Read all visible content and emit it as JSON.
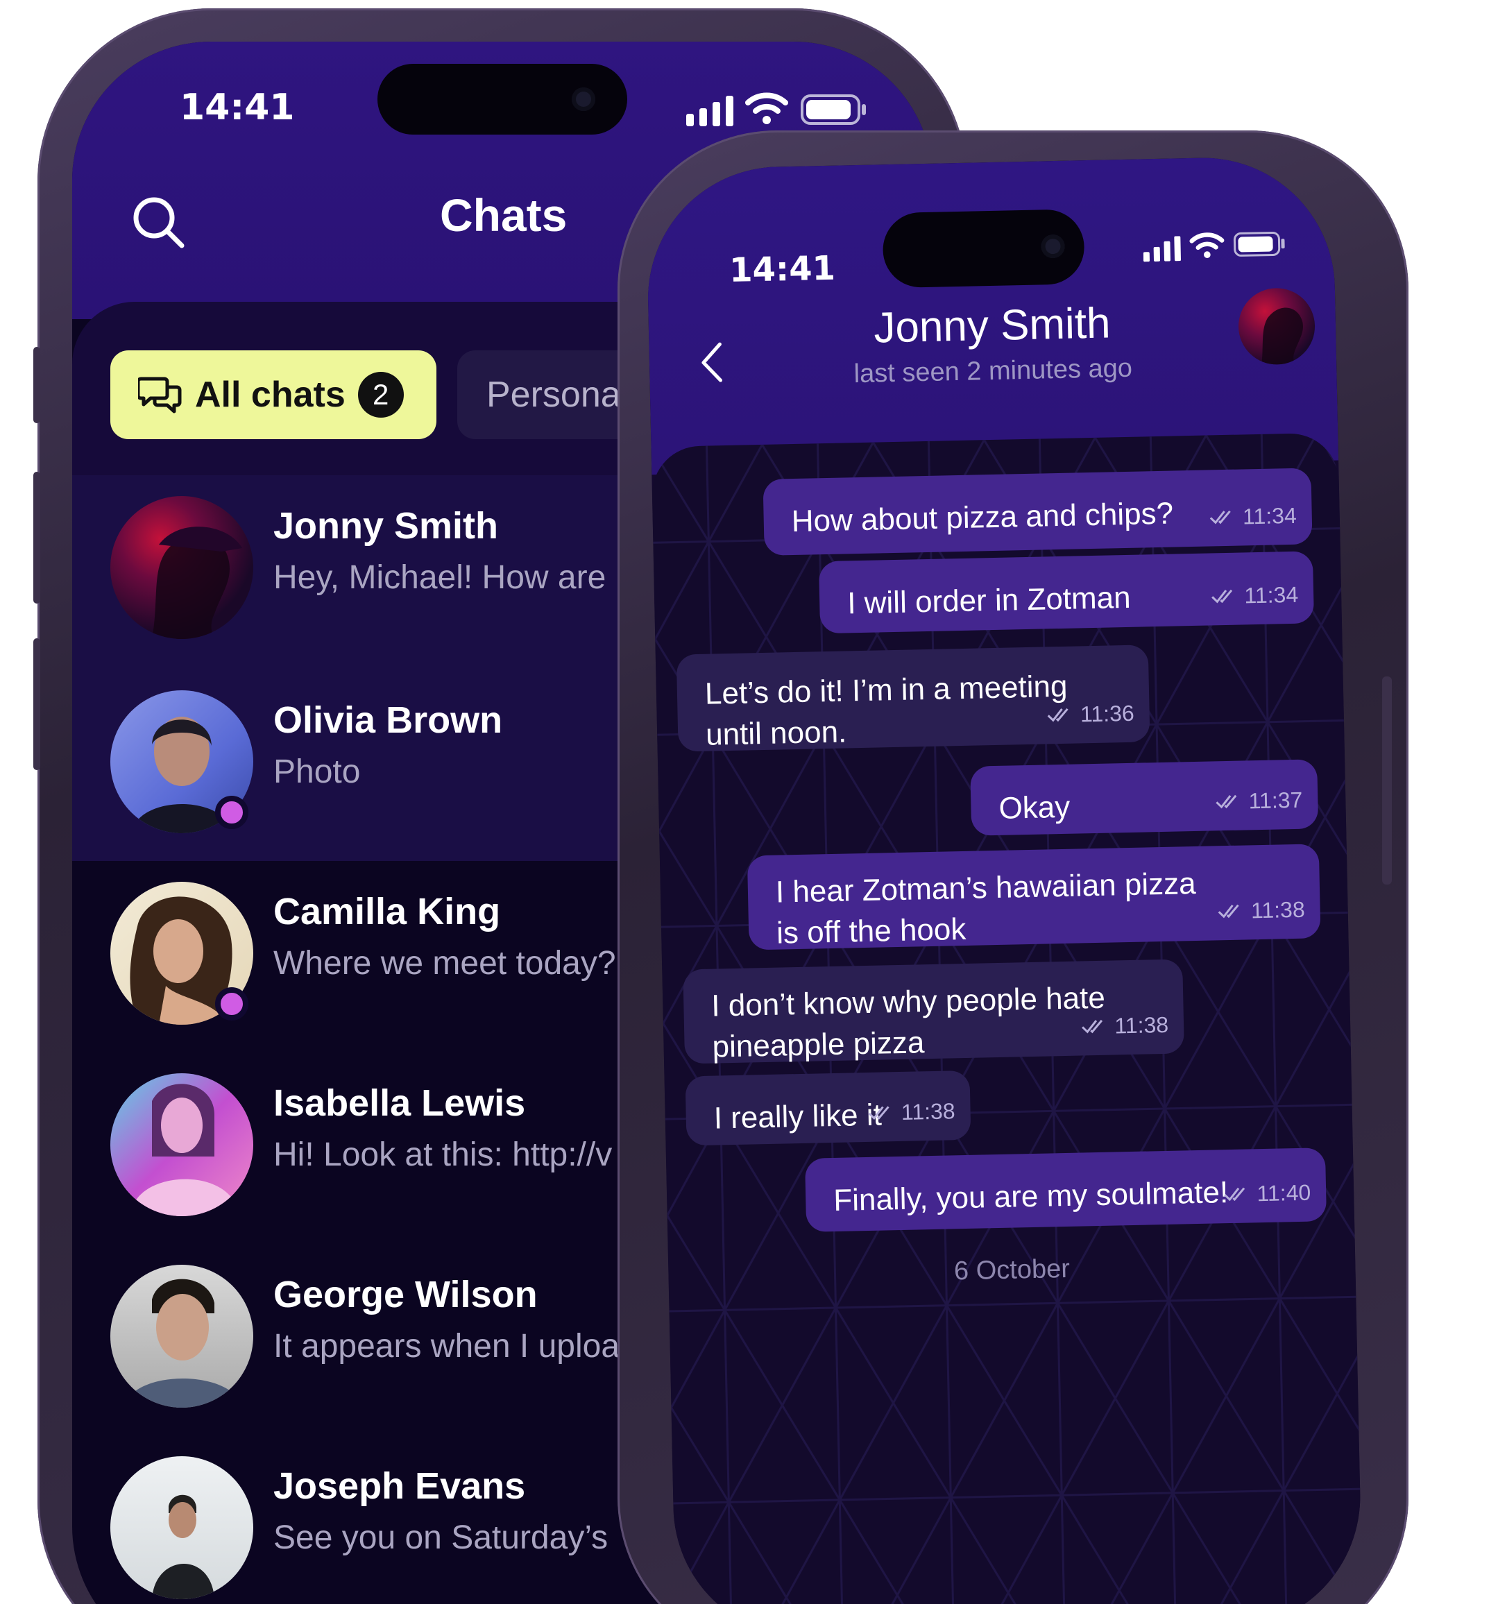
{
  "left_phone": {
    "status": {
      "time": "14:41"
    },
    "header": {
      "title": "Chats",
      "search_icon": "search-icon"
    },
    "filters": [
      {
        "label": "All chats",
        "count": "2",
        "icon": "chat-bubbles-icon",
        "active": true
      },
      {
        "label": "Persona",
        "active": false
      }
    ],
    "chats": [
      {
        "name": "Jonny Smith",
        "preview": "Hey, Michael! How are",
        "online": false,
        "highlighted": true
      },
      {
        "name": "Olivia Brown",
        "preview": "Photo",
        "online": true,
        "highlighted": true
      },
      {
        "name": "Camilla King",
        "preview": "Where we meet today?",
        "online": true,
        "highlighted": false
      },
      {
        "name": "Isabella Lewis",
        "preview": "Hi! Look at this: http://v",
        "online": false,
        "highlighted": false
      },
      {
        "name": "George Wilson",
        "preview": "It appears when I uploa",
        "online": false,
        "highlighted": false
      },
      {
        "name": "Joseph Evans",
        "preview": "See you on Saturday’s",
        "online": false,
        "highlighted": false
      }
    ]
  },
  "right_phone": {
    "status": {
      "time": "14:41"
    },
    "header": {
      "contact_name": "Jonny Smith",
      "last_seen": "last seen 2 minutes ago"
    },
    "messages": [
      {
        "direction": "out",
        "lines": [
          "How about pizza and chips?"
        ],
        "time": "11:34"
      },
      {
        "direction": "out",
        "lines": [
          "I will order in Zotman"
        ],
        "time": "11:34"
      },
      {
        "direction": "in",
        "lines": [
          "Let’s do it! I’m in a meeting",
          "until noon."
        ],
        "time": "11:36"
      },
      {
        "direction": "out",
        "lines": [
          "Okay"
        ],
        "time": "11:37"
      },
      {
        "direction": "out",
        "lines": [
          "I hear Zotman’s hawaiian pizza",
          "is off the hook"
        ],
        "time": "11:38"
      },
      {
        "direction": "in",
        "lines": [
          "I don’t know why people hate",
          "pineapple pizza"
        ],
        "time": "11:38"
      },
      {
        "direction": "in",
        "lines": [
          "I really like it"
        ],
        "time": "11:38"
      },
      {
        "direction": "out",
        "lines": [
          "Finally, you are my soulmate!"
        ],
        "time": "11:40"
      }
    ],
    "date_separator": "6 October"
  },
  "colors": {
    "header_purple": "#2f1580",
    "accent_yellow": "#eef79a",
    "outgoing_bubble": "#44268f",
    "incoming_bubble": "#2a1f52",
    "online_dot": "#d05ce4"
  }
}
